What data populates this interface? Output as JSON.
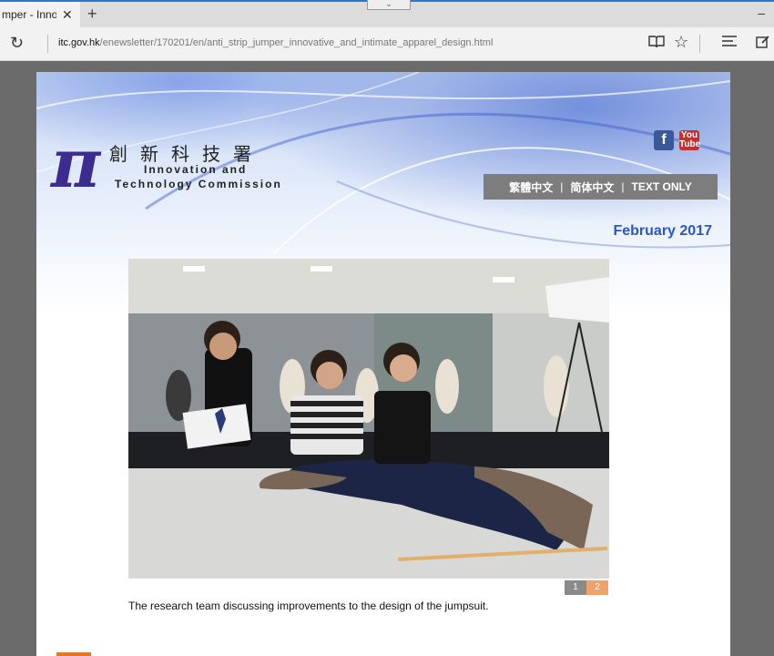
{
  "browser": {
    "tab_title": "mper - Inno",
    "tab_close": "✕",
    "new_tab": "+",
    "url_host": "itc.gov.hk",
    "url_path": "/enewsletter/170201/en/anti_strip_jumper_innovative_and_intimate_apparel_design.html",
    "icons": [
      "refresh-icon",
      "reading-view-icon",
      "favorite-star-icon",
      "hub-icon",
      "web-note-icon"
    ]
  },
  "site": {
    "logo_symbol": "π",
    "logo_chinese": "創新科技署",
    "logo_english_line1": "Innovation and",
    "logo_english_line2": "Technology Commission",
    "social": {
      "facebook": "f",
      "youtube_line1": "You",
      "youtube_line2": "Tube"
    },
    "languages": [
      "繁體中文",
      "简体中文",
      "TEXT ONLY"
    ],
    "lang_separator": "|",
    "issue_date": "February 2017"
  },
  "article": {
    "photo_alt": "The research team discussing improvements to the design of the jumpsuit.",
    "pager": [
      "1",
      "2"
    ],
    "active_page": "2",
    "caption": "The research team discussing improvements to the design of the jumpsuit."
  },
  "colors": {
    "accent_blue": "#2a56c6",
    "logo_purple": "#3d2c8f",
    "lang_bar_grey": "#7d7d7d",
    "pager_active": "#f0a26c"
  }
}
